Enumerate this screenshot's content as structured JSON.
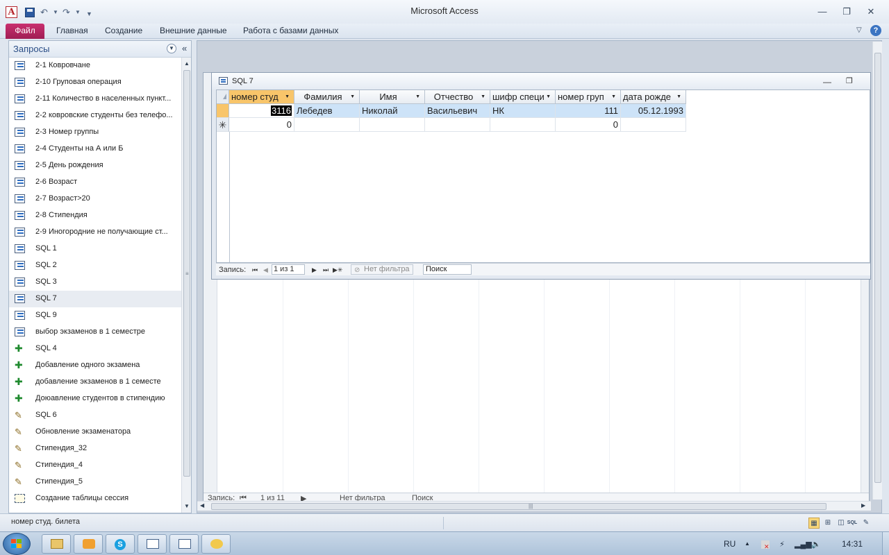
{
  "window": {
    "title": "Microsoft Access",
    "app_icon": "A"
  },
  "ribbon": {
    "tabs": [
      "Файл",
      "Главная",
      "Создание",
      "Внешние данные",
      "Работа с базами данных"
    ]
  },
  "nav_pane": {
    "title": "Запросы",
    "items": [
      {
        "label": "2-1 Ковровчане",
        "icon": "select-query-icon"
      },
      {
        "label": "2-10 Груповая операция",
        "icon": "select-query-icon"
      },
      {
        "label": "2-11 Количество в населенных пункт...",
        "icon": "select-query-icon"
      },
      {
        "label": "2-2 ковровские студенты без телефо...",
        "icon": "select-query-icon"
      },
      {
        "label": "2-3 Номер группы",
        "icon": "select-query-icon"
      },
      {
        "label": "2-4 Студенты на А или Б",
        "icon": "select-query-icon"
      },
      {
        "label": "2-5 День рождения",
        "icon": "select-query-icon"
      },
      {
        "label": "2-6 Возраст",
        "icon": "select-query-icon"
      },
      {
        "label": "2-7 Возраст>20",
        "icon": "select-query-icon"
      },
      {
        "label": "2-8  Стипендия",
        "icon": "select-query-icon"
      },
      {
        "label": "2-9 Иногородние не получающие ст...",
        "icon": "select-query-icon"
      },
      {
        "label": "SQL 1",
        "icon": "select-query-icon"
      },
      {
        "label": "SQL 2",
        "icon": "select-query-icon"
      },
      {
        "label": "SQL 3",
        "icon": "select-query-icon"
      },
      {
        "label": "SQL 7",
        "icon": "select-query-icon"
      },
      {
        "label": "SQL 9",
        "icon": "select-query-icon"
      },
      {
        "label": "выбор экзаменов в 1 семестре",
        "icon": "select-query-icon"
      },
      {
        "label": "SQL 4",
        "icon": "append-query-icon"
      },
      {
        "label": "Добавление одного экзамена",
        "icon": "append-query-icon"
      },
      {
        "label": "добавление экзаменов в 1 семесте",
        "icon": "append-query-icon"
      },
      {
        "label": "Доюавление студентов в стипендию",
        "icon": "append-query-icon"
      },
      {
        "label": "SQL 6",
        "icon": "update-query-icon"
      },
      {
        "label": "Обновление экзаменатора",
        "icon": "update-query-icon"
      },
      {
        "label": "Стипендия_32",
        "icon": "update-query-icon"
      },
      {
        "label": "Стипендия_4",
        "icon": "update-query-icon"
      },
      {
        "label": "Стипендия_5",
        "icon": "update-query-icon"
      },
      {
        "label": "Создание таблицы сессия",
        "icon": "make-table-query-icon"
      }
    ],
    "selected": "SQL 7"
  },
  "query_window": {
    "title": "SQL 7",
    "columns": [
      "номер студ",
      "Фамилия",
      "Имя",
      "Отчество",
      "шифр специ",
      "номер груп",
      "дата рожде"
    ],
    "rows": [
      [
        "3116",
        "Лебедев",
        "Николай",
        "Васильевич",
        "НК",
        "111",
        "05.12.1993"
      ]
    ],
    "new_row": [
      "0",
      "",
      "",
      "",
      "",
      "0",
      ""
    ],
    "record_nav": {
      "label": "Запись:",
      "position": "1 из 1",
      "filter": "Нет фильтра",
      "search": "Поиск"
    }
  },
  "background_form": {
    "record_nav": {
      "label": "Запись:",
      "position": "1 из 11",
      "filter": "Нет фильтра",
      "search": "Поиск"
    }
  },
  "status_bar": {
    "text": "номер студ. билета",
    "views": [
      "datasheet-view-icon",
      "pivot-table-view-icon",
      "pivot-chart-view-icon",
      "SQL",
      "design-view-icon"
    ]
  },
  "taskbar": {
    "language": "RU",
    "time": "14:31"
  }
}
